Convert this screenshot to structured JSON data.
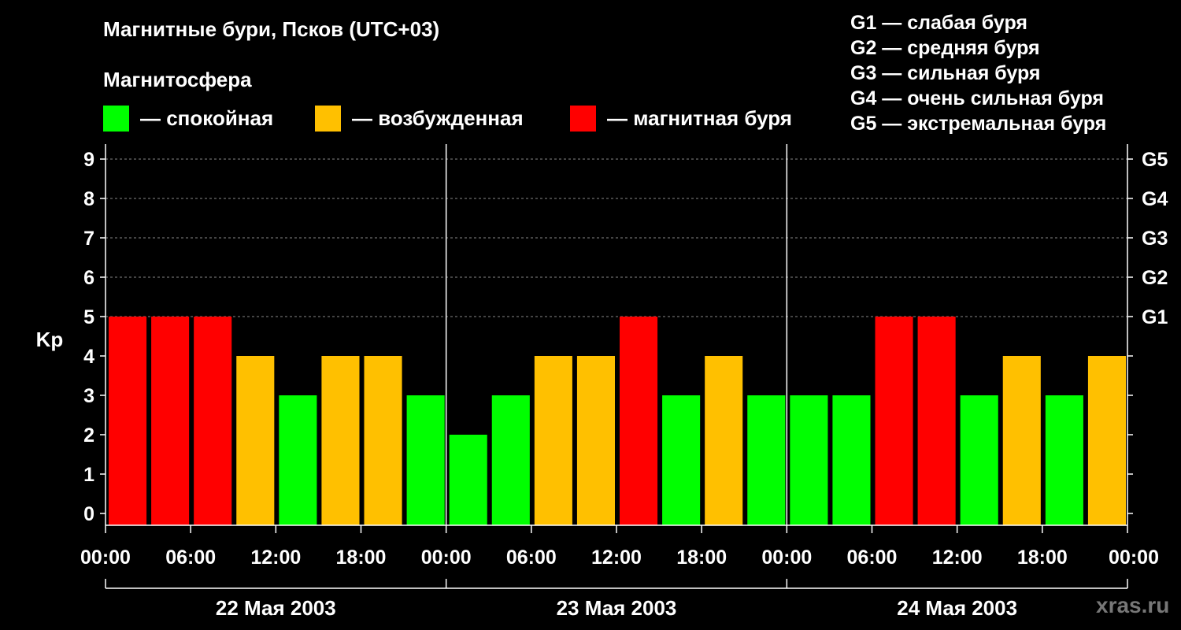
{
  "title": "Магнитные бури, Псков (UTC+03)",
  "subtitle": "Магнитосфера",
  "legend": [
    {
      "label": "— спокойная",
      "color": "#00ff00"
    },
    {
      "label": "— возбужденная",
      "color": "#ffc000"
    },
    {
      "label": "— магнитная буря",
      "color": "#ff0000"
    }
  ],
  "g_levels": [
    "G1 — слабая буря",
    "G2 — средняя буря",
    "G3 — сильная буря",
    "G4 — очень сильная буря",
    "G5 — экстремальная буря"
  ],
  "watermark": "xras.ru",
  "chart_data": {
    "type": "bar",
    "ylabel": "Kp",
    "ylim": [
      0,
      9
    ],
    "yticks": [
      0,
      1,
      2,
      3,
      4,
      5,
      6,
      7,
      8,
      9
    ],
    "right_axis_labels": [
      {
        "kp": 5,
        "label": "G1"
      },
      {
        "kp": 6,
        "label": "G2"
      },
      {
        "kp": 7,
        "label": "G3"
      },
      {
        "kp": 8,
        "label": "G4"
      },
      {
        "kp": 9,
        "label": "G5"
      }
    ],
    "grid": "dashed horizontal at Kp 5–9",
    "x_tick_labels": [
      "00:00",
      "06:00",
      "12:00",
      "18:00",
      "00:00",
      "06:00",
      "12:00",
      "18:00",
      "00:00",
      "06:00",
      "12:00",
      "18:00",
      "00:00"
    ],
    "days": [
      "22 Мая 2003",
      "23 Мая 2003",
      "24 Мая 2003"
    ],
    "colors": {
      "quiet": "#00ff00",
      "active": "#ffc000",
      "storm": "#ff0000"
    },
    "thresholds": {
      "active_from": 4,
      "storm_from": 5
    },
    "values": [
      5,
      5,
      5,
      4,
      3,
      4,
      4,
      3,
      2,
      3,
      4,
      4,
      5,
      3,
      4,
      3,
      3,
      3,
      5,
      5,
      3,
      4,
      3,
      4
    ]
  }
}
